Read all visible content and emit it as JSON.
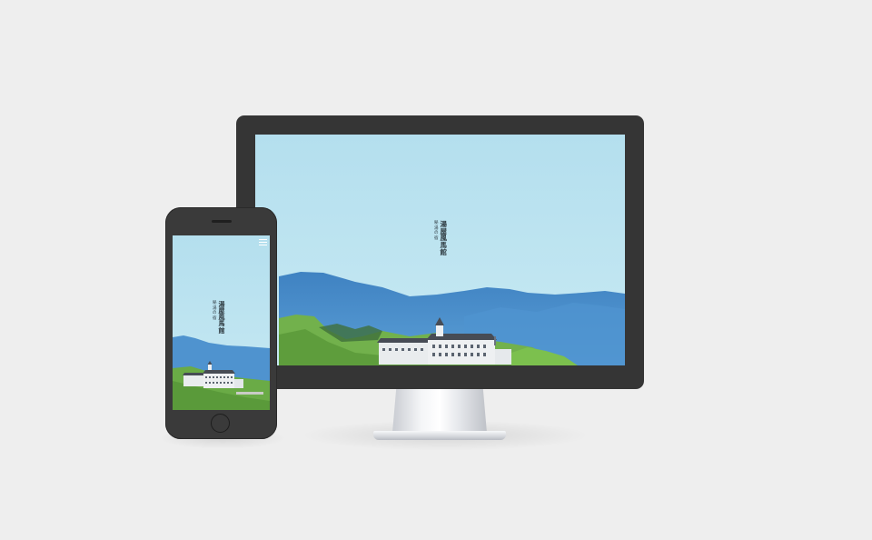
{
  "site": {
    "logo_main": "湯屋風馬館",
    "logo_sub": "秘湯の宿"
  },
  "phone": {
    "menu_icon": "hamburger-menu-icon"
  },
  "colors": {
    "background": "#eeeeee",
    "bezel": "#353535",
    "sky": "#b8e2ef",
    "mountains_far": "#5b9fd6",
    "mountains_near": "#4a8fcf",
    "forest": "#6fae4a"
  }
}
